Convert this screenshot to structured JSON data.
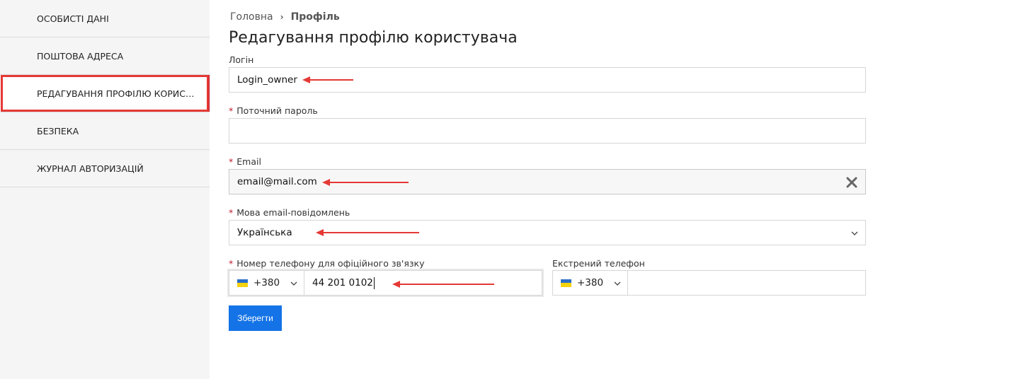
{
  "sidebar": {
    "items": [
      {
        "label": "ОСОБИСТІ ДАНІ"
      },
      {
        "label": "ПОШТОВА АДРЕСА"
      },
      {
        "label": "РЕДАГУВАННЯ ПРОФІЛЮ КОРИСТУВАЧА"
      },
      {
        "label": "БЕЗПЕКА"
      },
      {
        "label": "ЖУРНАЛ АВТОРИЗАЦІЙ"
      }
    ]
  },
  "breadcrumb": {
    "home": "Головна",
    "separator": "›",
    "current": "Профіль"
  },
  "page_title": "Редагування профілю користувача",
  "form": {
    "login": {
      "label": "Логін",
      "value": "Login_owner"
    },
    "current_password": {
      "required": "*",
      "label": "Поточний пароль",
      "value": ""
    },
    "email": {
      "required": "*",
      "label": "Email",
      "value": "email@mail.com"
    },
    "language": {
      "required": "*",
      "label": "Мова email-повідомлень",
      "value": "Українська"
    },
    "phone": {
      "required": "*",
      "label": "Номер телефону для офіційного зв'язку",
      "code": "+380",
      "number": "44 201 0102"
    },
    "emergency_phone": {
      "label": "Екстрений телефон",
      "code": "+380",
      "number": ""
    },
    "save_label": "Зберегти"
  },
  "colors": {
    "accent": "#1473e6",
    "required": "#c0192a",
    "annotation": "#e53935",
    "flag_blue": "#2a6ec9",
    "flag_yellow": "#f5d20b"
  },
  "icons": {
    "clear": "close-x-icon",
    "dropdown": "chevron-down-icon",
    "flag": "ukraine-flag-icon"
  }
}
